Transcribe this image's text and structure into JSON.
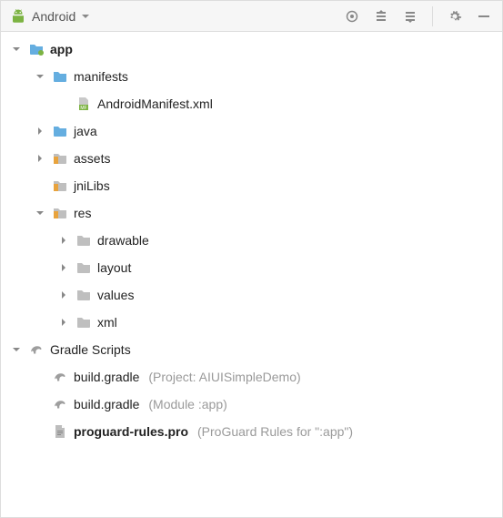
{
  "toolbar": {
    "title": "Android"
  },
  "tree": [
    {
      "id": "app",
      "depth": 0,
      "expand": "down",
      "icon": "module-folder",
      "label": "app",
      "bold": true
    },
    {
      "id": "manifests",
      "depth": 1,
      "expand": "down",
      "icon": "folder",
      "label": "manifests"
    },
    {
      "id": "manifest-xml",
      "depth": 2,
      "icon": "manifest-file",
      "label": "AndroidManifest.xml"
    },
    {
      "id": "java",
      "depth": 1,
      "expand": "right",
      "icon": "folder",
      "label": "java"
    },
    {
      "id": "assets",
      "depth": 1,
      "expand": "right",
      "icon": "resource-folder",
      "label": "assets"
    },
    {
      "id": "jnilibs",
      "depth": 1,
      "icon": "resource-folder",
      "label": "jniLibs"
    },
    {
      "id": "res",
      "depth": 1,
      "expand": "down",
      "icon": "resource-folder",
      "label": "res"
    },
    {
      "id": "drawable",
      "depth": 2,
      "expand": "right",
      "icon": "grey-folder",
      "label": "drawable"
    },
    {
      "id": "layout",
      "depth": 2,
      "expand": "right",
      "icon": "grey-folder",
      "label": "layout"
    },
    {
      "id": "values",
      "depth": 2,
      "expand": "right",
      "icon": "grey-folder",
      "label": "values"
    },
    {
      "id": "xml",
      "depth": 2,
      "expand": "right",
      "icon": "grey-folder",
      "label": "xml"
    },
    {
      "id": "gradle-scripts",
      "depth": 0,
      "expand": "down",
      "icon": "gradle",
      "label": "Gradle Scripts"
    },
    {
      "id": "build-gradle-project",
      "depth": 1,
      "icon": "gradle",
      "label": "build.gradle",
      "qualifier": "(Project: AIUISimpleDemo)"
    },
    {
      "id": "build-gradle-module",
      "depth": 1,
      "icon": "gradle",
      "label": "build.gradle",
      "qualifier": "(Module :app)"
    },
    {
      "id": "proguard",
      "depth": 1,
      "icon": "file",
      "label": "proguard-rules.pro",
      "qualifier": "(ProGuard Rules for \":app\")",
      "bold": true
    }
  ]
}
